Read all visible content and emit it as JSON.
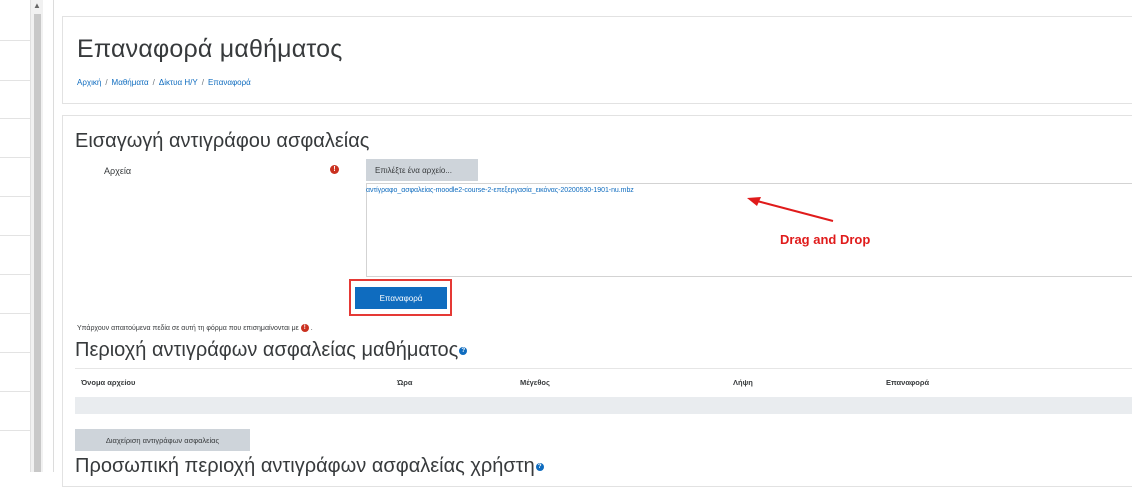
{
  "page": {
    "title": "Επαναφορά μαθήματος",
    "breadcrumb": [
      "Αρχική",
      "Μαθήματα",
      "Δίκτυα Η/Υ",
      "Επαναφορά"
    ]
  },
  "import_section": {
    "heading": "Εισαγωγή αντιγράφου ασφαλείας",
    "files_label": "Αρχεία",
    "required_symbol": "!",
    "choose_file_button": "Επιλέξτε ένα αρχείο...",
    "file_name": "αντίγραφο_ασφαλείας-moodle2-course-2-επεξεργασία_εικόνας-20200530-1901-nu.mbz",
    "annotation": "Drag and Drop",
    "restore_button": "Επαναφορά",
    "required_note": "Υπάρχουν απαιτούμενα πεδία σε αυτή τη φόρμα που επισημαίνονται με",
    "required_note_end": "."
  },
  "course_backup_area": {
    "heading": "Περιοχή αντιγράφων ασφαλείας μαθήματος",
    "columns": [
      "Όνομα αρχείου",
      "Ώρα",
      "Μέγεθος",
      "Λήψη",
      "Επαναφορά"
    ],
    "manage_button": "Διαχείριση αντιγράφων ασφαλείας"
  },
  "user_backup_area": {
    "heading": "Προσωπική περιοχή αντιγράφων ασφαλείας χρήστη"
  },
  "colors": {
    "link": "#0f6cbf",
    "annotation_red": "#e01b1b",
    "required_red": "#ca3120"
  }
}
